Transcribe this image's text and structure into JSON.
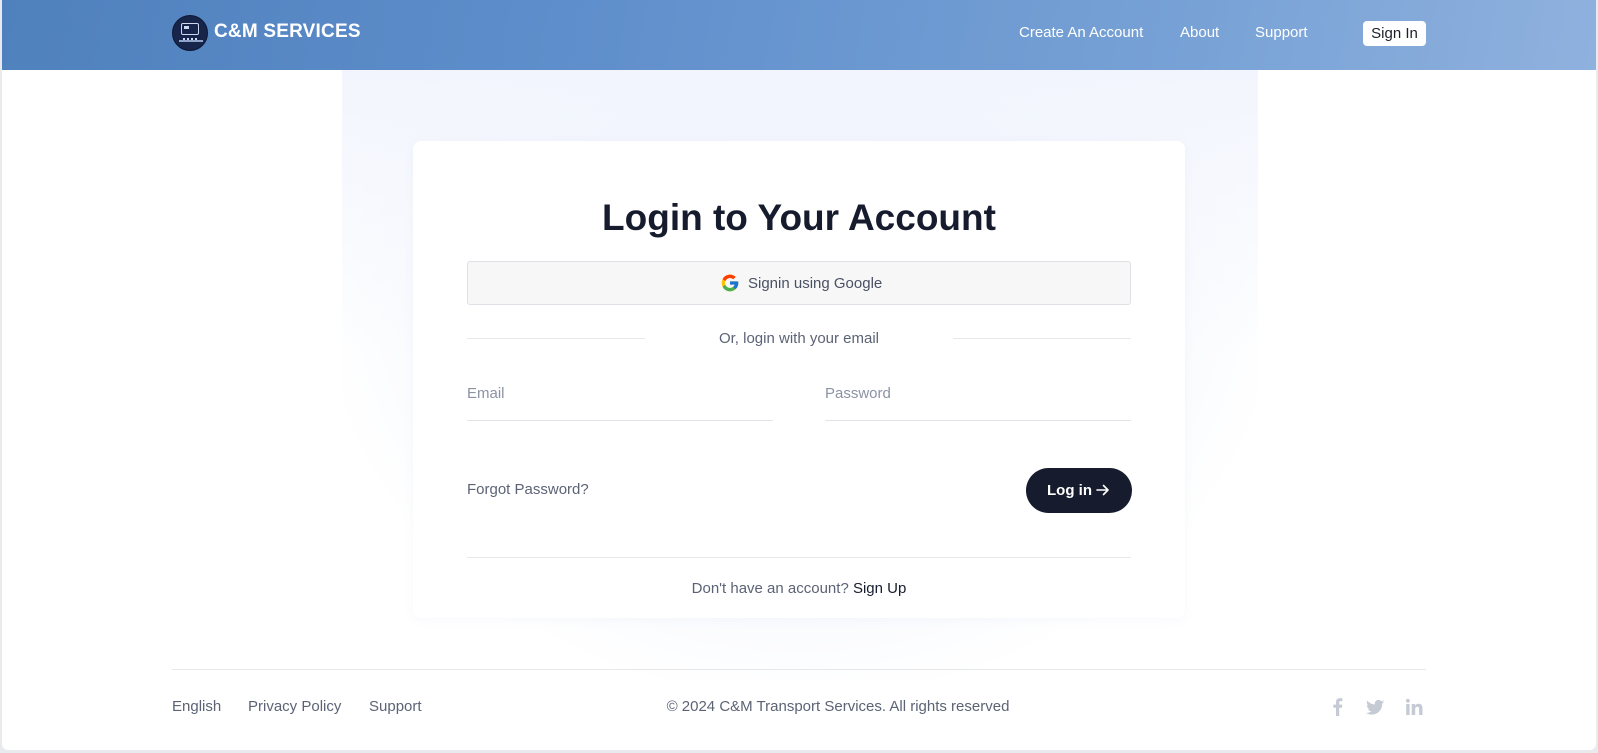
{
  "header": {
    "brand": "C&M SERVICES",
    "nav": {
      "create_account": "Create An Account",
      "about": "About",
      "support": "Support",
      "sign_in": "Sign In"
    }
  },
  "login": {
    "title": "Login to Your Account",
    "google_label": "Signin using Google",
    "divider_text": "Or, login with your email",
    "email_placeholder": "Email",
    "password_placeholder": "Password",
    "forgot_label": "Forgot Password?",
    "login_label": "Log in",
    "no_account_text": "Don't have an account?",
    "signup_label": "Sign Up"
  },
  "footer": {
    "links": {
      "language": "English",
      "privacy": "Privacy Policy",
      "support": "Support"
    },
    "copyright": "© 2024 C&M Transport Services. All rights reserved",
    "social_icons": [
      "facebook-icon",
      "twitter-icon",
      "linkedin-icon"
    ]
  },
  "colors": {
    "header_gradient_start": "#4f81bd",
    "header_gradient_end": "#8fb1de",
    "primary_dark": "#161c2d",
    "muted_text": "#5b6375",
    "social_icon": "#c5cad5"
  }
}
